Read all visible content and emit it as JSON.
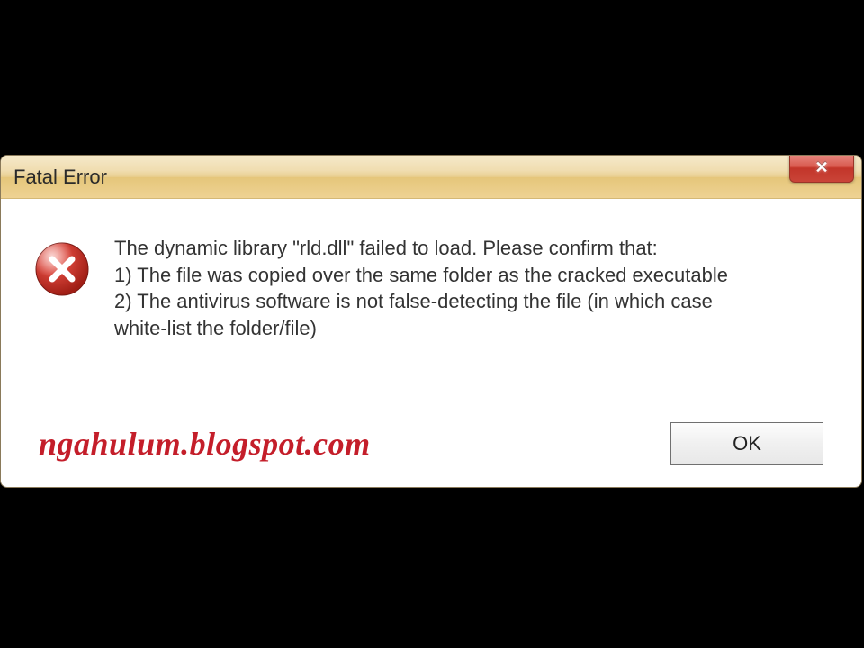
{
  "dialog": {
    "title": "Fatal Error",
    "message": {
      "intro": "The dynamic library \"rld.dll\" failed to load. Please confirm that:",
      "point1": "1) The file was copied over the same folder as the cracked executable",
      "point2": "2) The antivirus software is not false-detecting the file (in which case",
      "point2b": "white-list the folder/file)"
    },
    "ok_label": "OK"
  },
  "watermark": "ngahulum.blogspot.com",
  "icons": {
    "close": "✕",
    "error": "error"
  }
}
